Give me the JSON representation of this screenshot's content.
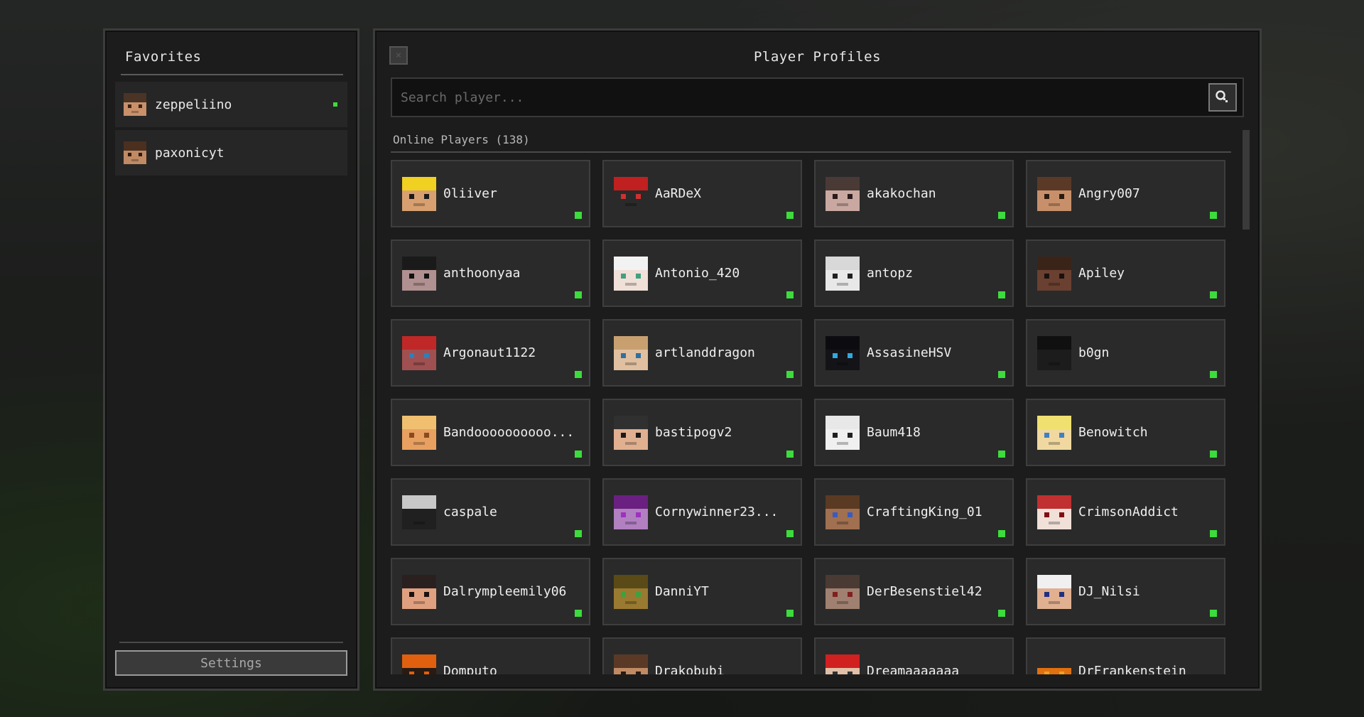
{
  "favorites": {
    "title": "Favorites",
    "items": [
      {
        "name": "zeppeliino",
        "online": true,
        "skin": "#c9906a",
        "hair": "#4a3426",
        "eye": "#3b2314"
      },
      {
        "name": "paxonicyt",
        "online": false,
        "skin": "#c08a64",
        "hair": "#4b3020",
        "eye": "#2d1a10"
      }
    ],
    "settings_label": "Settings"
  },
  "main": {
    "title": "Player Profiles",
    "close_label": "×",
    "search": {
      "placeholder": "Search player..."
    },
    "online_header": "Online Players (138)",
    "players": [
      {
        "name": "0liiver",
        "skin": "#d8a070",
        "hair": "#f0d020",
        "eye": "#1a1a1a"
      },
      {
        "name": "AaRDeX",
        "skin": "#2a2a2a",
        "hair": "#c02020",
        "eye": "#d03030"
      },
      {
        "name": "akakochan",
        "skin": "#c8a8a0",
        "hair": "#4a3a36",
        "eye": "#2a1a1a"
      },
      {
        "name": "Angry007",
        "skin": "#c8906a",
        "hair": "#5a3a26",
        "eye": "#2a1a10"
      },
      {
        "name": "anthoonyaa",
        "skin": "#b09090",
        "hair": "#1a1a1a",
        "eye": "#111111"
      },
      {
        "name": "Antonio_420",
        "skin": "#f0e0d8",
        "hair": "#f2f2f2",
        "eye": "#40a080"
      },
      {
        "name": "antopz",
        "skin": "#e8e8e8",
        "hair": "#d8d8d8",
        "eye": "#202020"
      },
      {
        "name": "Apiley",
        "skin": "#6a4030",
        "hair": "#3a2418",
        "eye": "#1a1010"
      },
      {
        "name": "Argonaut1122",
        "skin": "#a05050",
        "hair": "#c02828",
        "eye": "#2a80c0"
      },
      {
        "name": "artlanddragon",
        "skin": "#e0c0a0",
        "hair": "#c8a070",
        "eye": "#3070a0"
      },
      {
        "name": "AssasineHSV",
        "skin": "#141418",
        "hair": "#0c0c10",
        "eye": "#30a8e0"
      },
      {
        "name": "b0gn",
        "skin": "#1c1c1c",
        "hair": "#101010",
        "eye": "#1c1c1c"
      },
      {
        "name": "Bandoooooooooo...",
        "skin": "#e8a060",
        "hair": "#f0c070",
        "eye": "#8a4a20"
      },
      {
        "name": "bastipogv2",
        "skin": "#e0b090",
        "hair": "#303030",
        "eye": "#1a1a1a"
      },
      {
        "name": "Baum418",
        "skin": "#f0f0f0",
        "hair": "#e8e8e8",
        "eye": "#202020"
      },
      {
        "name": "Benowitch",
        "skin": "#f0d8a0",
        "hair": "#f0e070",
        "eye": "#4080c0"
      },
      {
        "name": "caspale",
        "skin": "#202020",
        "hair": "#c8c8c8",
        "eye": "#202020"
      },
      {
        "name": "Cornywinner23...",
        "skin": "#b080c0",
        "hair": "#6a2080",
        "eye": "#a030c0"
      },
      {
        "name": "CraftingKing_01",
        "skin": "#a07050",
        "hair": "#5a3a22",
        "eye": "#3a5ac0"
      },
      {
        "name": "CrimsonAddict",
        "skin": "#f0e0d8",
        "hair": "#c03030",
        "eye": "#801010"
      },
      {
        "name": "Dalrympleemily06",
        "skin": "#e0a080",
        "hair": "#2a2020",
        "eye": "#1a1010"
      },
      {
        "name": "DanniYT",
        "skin": "#9a7a30",
        "hair": "#5a4a18",
        "eye": "#40a040"
      },
      {
        "name": "DerBesenstiel42",
        "skin": "#a08070",
        "hair": "#4a3a34",
        "eye": "#802020"
      },
      {
        "name": "DJ_Nilsi",
        "skin": "#e0b090",
        "hair": "#f0f0f0",
        "eye": "#203080"
      },
      {
        "name": "Domputo",
        "skin": "#2a1a10",
        "hair": "#e06010",
        "eye": "#e06010"
      },
      {
        "name": "Drakobubi",
        "skin": "#c08a64",
        "hair": "#5a3a26",
        "eye": "#2a1a10"
      },
      {
        "name": "Dreamaaaaaaa",
        "skin": "#e0c0a8",
        "hair": "#d02020",
        "eye": "#303030"
      },
      {
        "name": "DrFrankenstein",
        "skin": "#e07010",
        "hair": "#2a2a2a",
        "eye": "#f0a020"
      }
    ]
  },
  "colors": {
    "online": "#3cdc3c",
    "panel": "#1c1c1c",
    "card": "#2a2a2a"
  }
}
